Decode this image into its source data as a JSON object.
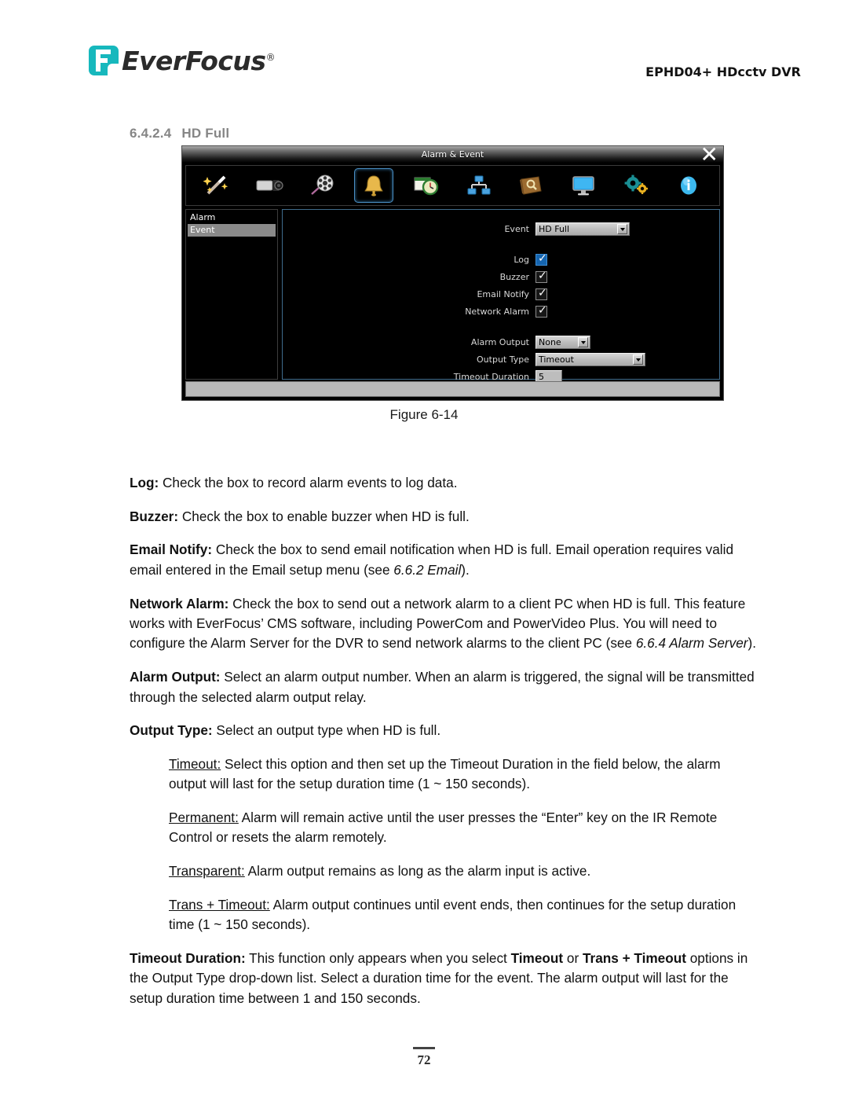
{
  "header": {
    "brand": "EverFocus",
    "brand_registered": "®",
    "model_line": "EPHD04+  HDcctv DVR"
  },
  "section": {
    "number": "6.4.2.4",
    "title": "HD Full"
  },
  "dvr_dialog": {
    "title": "Alarm & Event",
    "close_label": "✕",
    "toolbar_icons": [
      "magic-wand-icon",
      "camera-icon",
      "film-reel-icon",
      "bell-icon",
      "schedule-clock-icon",
      "network-icon",
      "disk-search-icon",
      "monitor-icon",
      "gears-icon",
      "info-icon"
    ],
    "toolbar_selected_index": 3,
    "sidebar": {
      "items": [
        {
          "label": "Alarm",
          "selected": false
        },
        {
          "label": "Event",
          "selected": true
        }
      ]
    },
    "fields": {
      "event_label": "Event",
      "event_value": "HD Full",
      "log_label": "Log",
      "log_checked": true,
      "log_focused": true,
      "buzzer_label": "Buzzer",
      "buzzer_checked": true,
      "email_notify_label": "Email Notify",
      "email_notify_checked": true,
      "network_alarm_label": "Network Alarm",
      "network_alarm_checked": true,
      "alarm_output_label": "Alarm Output",
      "alarm_output_value": "None",
      "output_type_label": "Output Type",
      "output_type_value": "Timeout",
      "timeout_duration_label": "Timeout Duration",
      "timeout_duration_value": "5"
    }
  },
  "figure_caption": "Figure 6-14",
  "body": {
    "log": {
      "term": "Log:",
      "text": " Check the box to record alarm events to log data."
    },
    "buzzer": {
      "term": "Buzzer:",
      "text": " Check the box to enable buzzer when HD is full."
    },
    "email_notify": {
      "term": "Email Notify:",
      "text": " Check the box to send email notification when HD is full. Email operation requires valid email entered in the Email setup menu (see ",
      "ref": "6.6.2 Email",
      "text_after": ")."
    },
    "network_alarm": {
      "term": "Network Alarm:",
      "text": " Check the box to send out a network alarm to a client PC when HD is full. This feature works with EverFocus’ CMS software, including PowerCom and PowerVideo Plus. You will need to configure the Alarm Server for the DVR to send network alarms to the client PC (see ",
      "ref": "6.6.4 Alarm Server",
      "text_after": ")."
    },
    "alarm_output": {
      "term": "Alarm Output:",
      "text": " Select an alarm output number. When an alarm is triggered, the signal will be transmitted through the selected alarm output relay."
    },
    "output_type": {
      "term": "Output Type:",
      "text": " Select an output type when HD is full."
    },
    "timeout": {
      "term": "Timeout:",
      "text": " Select this option and then set up the Timeout Duration in the field below, the alarm output will last for the setup duration time (1 ~ 150 seconds)."
    },
    "permanent": {
      "term": "Permanent:",
      "text": " Alarm will remain active until the user presses the “Enter” key on the IR Remote Control or resets the alarm remotely."
    },
    "transparent": {
      "term": "Transparent:",
      "text": " Alarm output remains as long as the alarm input is active."
    },
    "trans_timeout": {
      "term": "Trans + Timeout:",
      "text": " Alarm output continues until event ends, then continues for the setup duration time (1 ~ 150 seconds)."
    },
    "timeout_duration": {
      "term": "Timeout Duration:",
      "text": " This function only appears when you select ",
      "bold1": "Timeout",
      "mid": " or ",
      "bold2": "Trans + Timeout",
      "text_after": " options in the Output Type drop-down list. Select a duration time for the event. The alarm output will last for the setup duration time between 1 and 150 seconds."
    }
  },
  "footer": {
    "page_number": "72"
  }
}
